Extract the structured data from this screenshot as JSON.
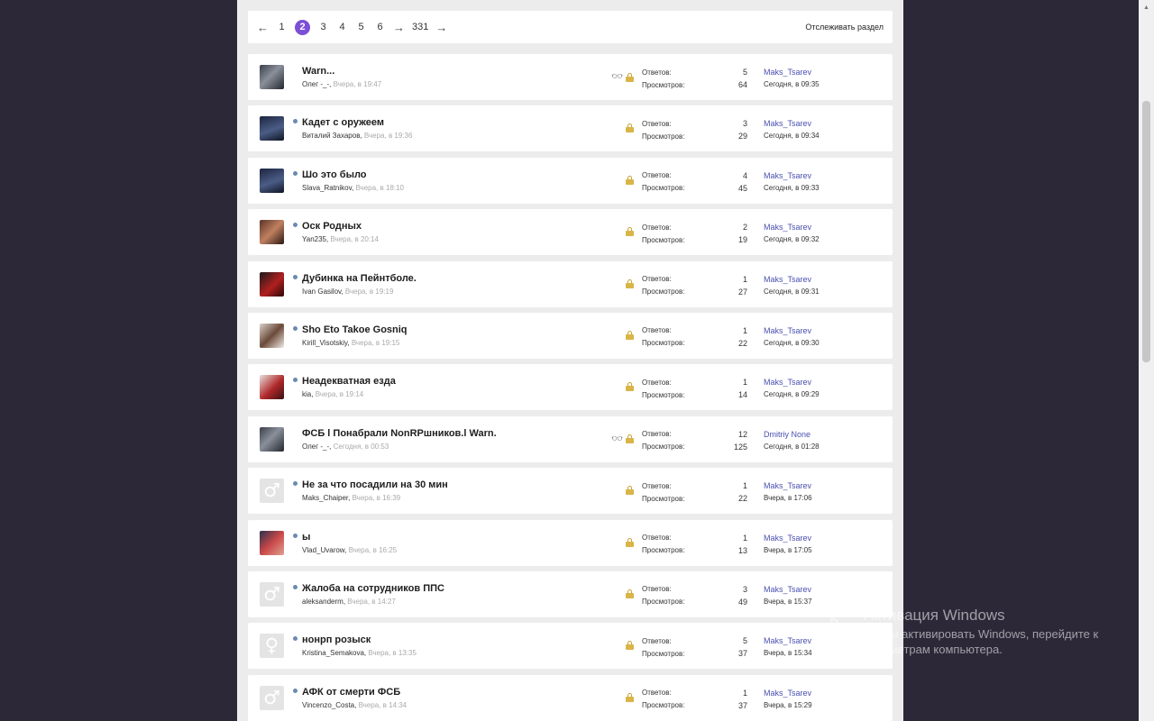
{
  "pagination": {
    "prev_arrow": "←",
    "pages": [
      "1",
      "2",
      "3",
      "4",
      "5",
      "6"
    ],
    "current_page": "2",
    "ellipsis_arrow": "→",
    "last_page": "331",
    "next_arrow": "→",
    "follow_label": "Отслеживать раздел"
  },
  "labels": {
    "replies": "Ответов:",
    "views": "Просмотров:"
  },
  "threads": [
    {
      "title": "Warn...",
      "author": "Олег -_-",
      "date": "Вчера, в 19:47",
      "watched": true,
      "locked": true,
      "unread": false,
      "replies": "5",
      "views": "64",
      "last_user": "Maks_Tsarev",
      "last_date": "Сегодня, в 09:35",
      "avatar": "photo"
    },
    {
      "title": "Кадет с оружеем",
      "author": "Виталий Захаров",
      "date": "Вчера, в 19:36",
      "watched": false,
      "locked": true,
      "unread": true,
      "replies": "3",
      "views": "29",
      "last_user": "Maks_Tsarev",
      "last_date": "Сегодня, в 09:34",
      "avatar": "dark"
    },
    {
      "title": "Шо это было",
      "author": "Slava_Ratnikov",
      "date": "Вчера, в 18:10",
      "watched": false,
      "locked": true,
      "unread": true,
      "replies": "4",
      "views": "45",
      "last_user": "Maks_Tsarev",
      "last_date": "Сегодня, в 09:33",
      "avatar": "dark"
    },
    {
      "title": "Оск Родных",
      "author": "Yan235",
      "date": "Вчера, в 20:14",
      "watched": false,
      "locked": true,
      "unread": true,
      "replies": "2",
      "views": "19",
      "last_user": "Maks_Tsarev",
      "last_date": "Сегодня, в 09:32",
      "avatar": "warm"
    },
    {
      "title": "Дубинка на Пейнтболе.",
      "author": "Ivan Gasilov",
      "date": "Вчера, в 19:19",
      "watched": false,
      "locked": true,
      "unread": true,
      "replies": "1",
      "views": "27",
      "last_user": "Maks_Tsarev",
      "last_date": "Сегодня, в 09:31",
      "avatar": "red"
    },
    {
      "title": "Sho Eto Takoe Gosniq",
      "author": "Kirill_Visotskiy",
      "date": "Вчера, в 19:15",
      "watched": false,
      "locked": true,
      "unread": true,
      "replies": "1",
      "views": "22",
      "last_user": "Maks_Tsarev",
      "last_date": "Сегодня, в 09:30",
      "avatar": "girl"
    },
    {
      "title": "Неадекватная езда",
      "author": "kia",
      "date": "Вчера, в 19:14",
      "watched": false,
      "locked": true,
      "unread": true,
      "replies": "1",
      "views": "14",
      "last_user": "Maks_Tsarev",
      "last_date": "Сегодня, в 09:29",
      "avatar": "car"
    },
    {
      "title": "ФСБ l Понабрали NonRPшников.l Warn.",
      "author": "Олег -_-",
      "date": "Сегодня, в 00:53",
      "watched": true,
      "locked": true,
      "unread": false,
      "replies": "12",
      "views": "125",
      "last_user": "Dmitriy None",
      "last_date": "Сегодня, в 01:28",
      "avatar": "photo"
    },
    {
      "title": "Не за что посадили на 30 мин",
      "author": "Maks_Chaiper",
      "date": "Вчера, в 16:39",
      "watched": false,
      "locked": true,
      "unread": true,
      "replies": "1",
      "views": "22",
      "last_user": "Maks_Tsarev",
      "last_date": "Вчера, в 17:06",
      "avatar": "male"
    },
    {
      "title": "ы",
      "author": "Vlad_Uvarow",
      "date": "Вчера, в 16:25",
      "watched": false,
      "locked": true,
      "unread": true,
      "replies": "1",
      "views": "13",
      "last_user": "Maks_Tsarev",
      "last_date": "Вчера, в 17:05",
      "avatar": "hand"
    },
    {
      "title": "Жалоба на сотрудников ППС",
      "author": "aleksanderm",
      "date": "Вчера, в 14:27",
      "watched": false,
      "locked": true,
      "unread": true,
      "replies": "3",
      "views": "49",
      "last_user": "Maks_Tsarev",
      "last_date": "Вчера, в 15:37",
      "avatar": "male"
    },
    {
      "title": "нонрп розыск",
      "author": "Kristina_Semakova",
      "date": "Вчера, в 13:35",
      "watched": false,
      "locked": true,
      "unread": true,
      "replies": "5",
      "views": "37",
      "last_user": "Maks_Tsarev",
      "last_date": "Вчера, в 15:34",
      "avatar": "female"
    },
    {
      "title": "АФК от смерти ФСБ",
      "author": "Vincenzo_Costa",
      "date": "Вчера, в 14:34",
      "watched": false,
      "locked": true,
      "unread": true,
      "replies": "1",
      "views": "37",
      "last_user": "Maks_Tsarev",
      "last_date": "Вчера, в 15:29",
      "avatar": "male"
    }
  ],
  "icons": {
    "glasses": "glasses-icon",
    "lock": "lock-icon",
    "male": "♂",
    "female": "♀"
  },
  "windows_activation": {
    "title": "Активация Windows",
    "subtitle": "Чтобы активировать Windows, перейдите к параметрам компьютера."
  },
  "colors": {
    "accent": "#7b4fd6",
    "link": "#4a50b0",
    "background": "#2c2838"
  }
}
